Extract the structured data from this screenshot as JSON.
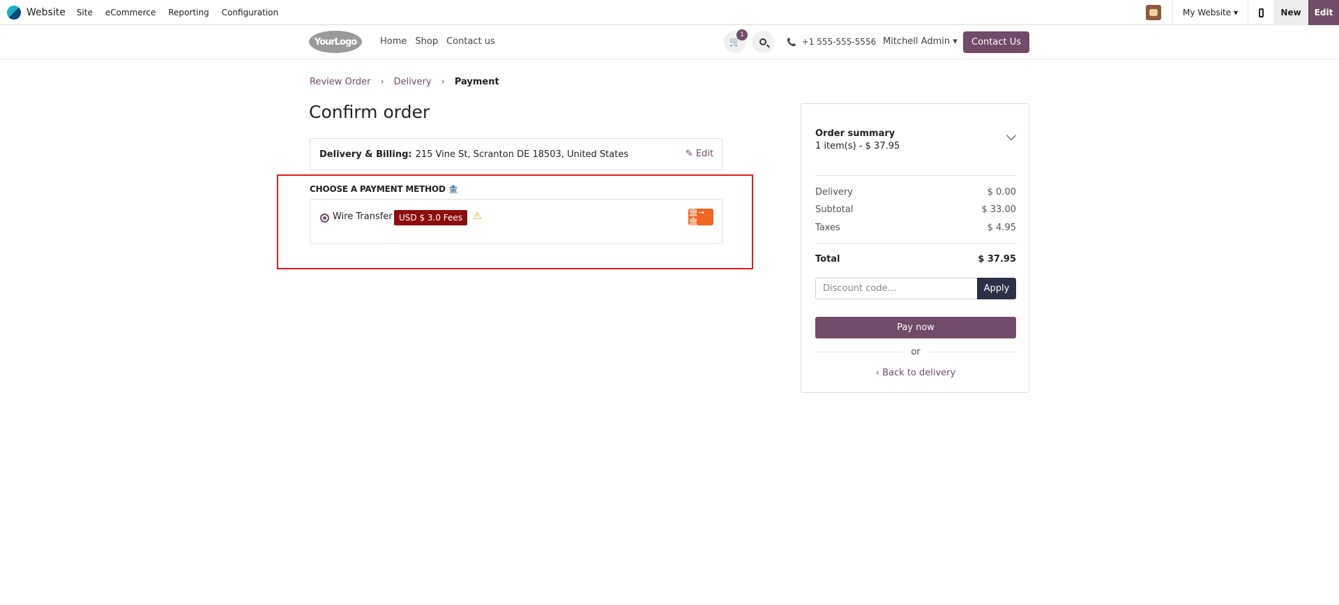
{
  "topbar": {
    "app_name": "Website",
    "menu": [
      "Site",
      "eCommerce",
      "Reporting",
      "Configuration"
    ],
    "website_selector": "My Website",
    "new_label": "New",
    "edit_label": "Edit"
  },
  "header": {
    "logo_text": "YourLogo",
    "nav": [
      "Home",
      "Shop",
      "Contact us"
    ],
    "cart_count": "1",
    "phone": "+1 555-555-5556",
    "user": "Mitchell Admin",
    "contact_button": "Contact Us"
  },
  "breadcrumb": {
    "step1": "Review Order",
    "step2": "Delivery",
    "step3": "Payment"
  },
  "page_title": "Confirm order",
  "address": {
    "label": "Delivery & Billing:",
    "value": "215 Vine St, Scranton DE 18503, United States",
    "edit": "Edit"
  },
  "payment": {
    "title": "CHOOSE A PAYMENT METHOD",
    "method_name": "Wire Transfer",
    "fee_badge": "USD $ 3.0 Fees",
    "selected": true
  },
  "summary": {
    "title": "Order summary",
    "items_line": "1 item(s) -  $ 37.95",
    "rows": [
      {
        "label": "Delivery",
        "value": "$ 0.00"
      },
      {
        "label": "Subtotal",
        "value": "$ 33.00"
      },
      {
        "label": "Taxes",
        "value": "$ 4.95"
      }
    ],
    "total_label": "Total",
    "total_value": "$ 37.95",
    "discount_placeholder": "Discount code...",
    "apply_label": "Apply",
    "pay_label": "Pay now",
    "or_label": "or",
    "back_label": "Back to delivery"
  },
  "icons": {
    "cart": "cart-icon",
    "search": "search-icon",
    "phone": "phone-icon",
    "warning": "warning-icon",
    "bank": "bank-transfer-icon"
  },
  "colors": {
    "brand": "#714b67",
    "fee_badge": "#8b0d0d",
    "highlight": "#e31b1b",
    "bank_icon": "#f06424"
  }
}
